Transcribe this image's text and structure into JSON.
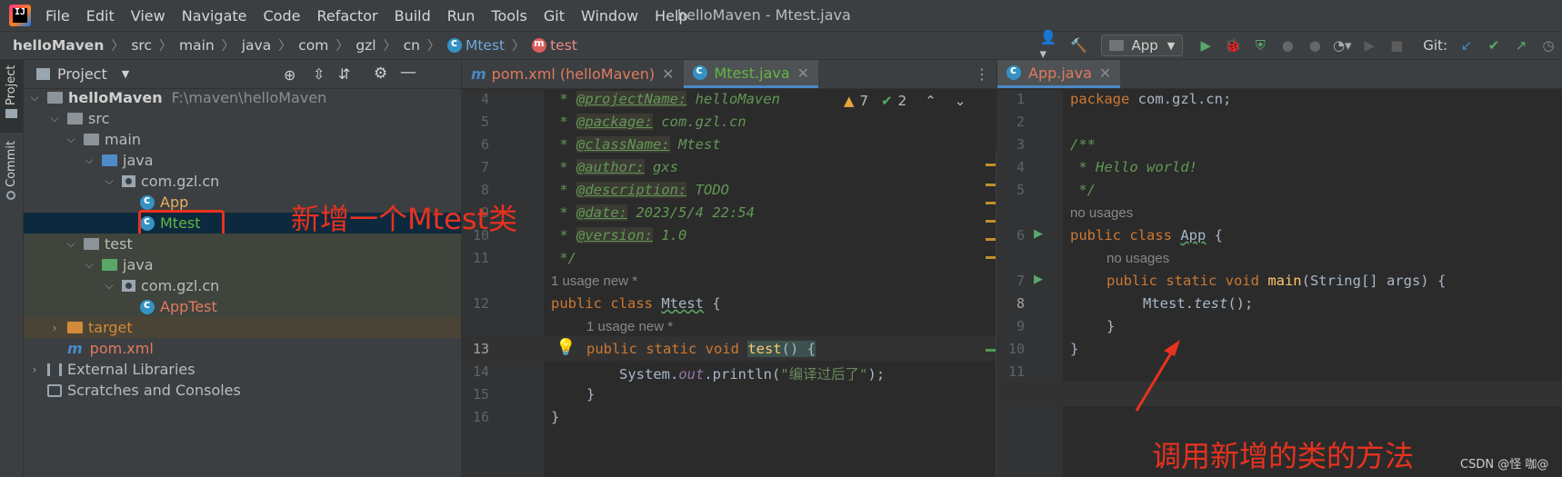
{
  "menu": {
    "items": [
      "File",
      "Edit",
      "View",
      "Navigate",
      "Code",
      "Refactor",
      "Build",
      "Run",
      "Tools",
      "Git",
      "Window",
      "Help"
    ],
    "window_title": "helloMaven - Mtest.java"
  },
  "breadcrumb": {
    "items": [
      "helloMaven",
      "src",
      "main",
      "java",
      "com",
      "gzl",
      "cn"
    ],
    "class_name": "Mtest",
    "method_name": "test"
  },
  "toolbar": {
    "run_config": "App",
    "git_label": "Git:"
  },
  "side_strip": {
    "project": "Project",
    "commit": "Commit"
  },
  "project_panel": {
    "title": "Project",
    "tree": [
      {
        "label": "helloMaven",
        "extra": "F:\\maven\\helloMaven"
      },
      {
        "label": "src"
      },
      {
        "label": "main"
      },
      {
        "label": "java"
      },
      {
        "label": "com.gzl.cn"
      },
      {
        "label": "App"
      },
      {
        "label": "Mtest"
      },
      {
        "label": "test"
      },
      {
        "label": "java"
      },
      {
        "label": "com.gzl.cn"
      },
      {
        "label": "AppTest"
      },
      {
        "label": "target"
      },
      {
        "label": "pom.xml"
      },
      {
        "label": "External Libraries"
      },
      {
        "label": "Scratches and Consoles"
      }
    ]
  },
  "editor_left": {
    "tabs": [
      {
        "label": "pom.xml (helloMaven)"
      },
      {
        "label": "Mtest.java"
      }
    ],
    "warnings": "7",
    "ok": "2",
    "line_numbers": [
      "4",
      "5",
      "6",
      "7",
      "8",
      "9",
      "10",
      "11",
      "12",
      "13",
      "14",
      "15",
      "16"
    ],
    "lines": {
      "l4_tag": "@projectName:",
      "l4_val": " helloMaven",
      "l5_tag": "@package:",
      "l5_val": " com.gzl.cn",
      "l6_tag": "@className:",
      "l6_val": " Mtest",
      "l7_tag": "@author:",
      "l7_val": " gxs",
      "l8_tag": "@description:",
      "l8_val": " TODO",
      "l9_tag": "@date:",
      "l9_val": " 2023/5/4 22:54",
      "l10_tag": "@version:",
      "l10_val": " 1.0",
      "l11": " */",
      "hint1": "1 usage    new *",
      "l12_kw": "public class ",
      "l12_name": "Mtest",
      "l12_rest": " {",
      "hint2": "1 usage    new *",
      "l13_kw": "public static void ",
      "l13_name": "test",
      "l13_rest": "() {",
      "l14_a": "System.",
      "l14_f": "out",
      "l14_b": ".println(",
      "l14_s": "\"编译过后了\"",
      "l14_c": ");",
      "l15": "}",
      "l16": "}"
    }
  },
  "editor_right": {
    "tabs": [
      {
        "label": "App.java"
      }
    ],
    "line_numbers": [
      "1",
      "2",
      "3",
      "4",
      "5",
      "6",
      "7",
      "8",
      "9",
      "10",
      "11"
    ],
    "lines": {
      "l1_kw": "package ",
      "l1_rest": "com.gzl.cn;",
      "l3": "/**",
      "l4": " * Hello world!",
      "l5": " */",
      "hint1": "no usages",
      "l6_kw": "public class ",
      "l6_name": "App",
      "l6_rest": " {",
      "hint2": "no usages",
      "l7_kw": "public static void ",
      "l7_name": "main",
      "l7_rest": "(String[] args) {",
      "l8_a": "Mtest.",
      "l8_f": "test",
      "l8_b": "();",
      "l9": "}",
      "l10": "}"
    }
  },
  "annotations": {
    "added_class": "新增一个Mtest类",
    "call_method": "调用新增的类的方法",
    "watermark": "CSDN @怪 咖@"
  },
  "colors": {
    "annotation_red": "#e8321f",
    "accent_blue": "#4a88c7",
    "selection": "#0d293e"
  }
}
